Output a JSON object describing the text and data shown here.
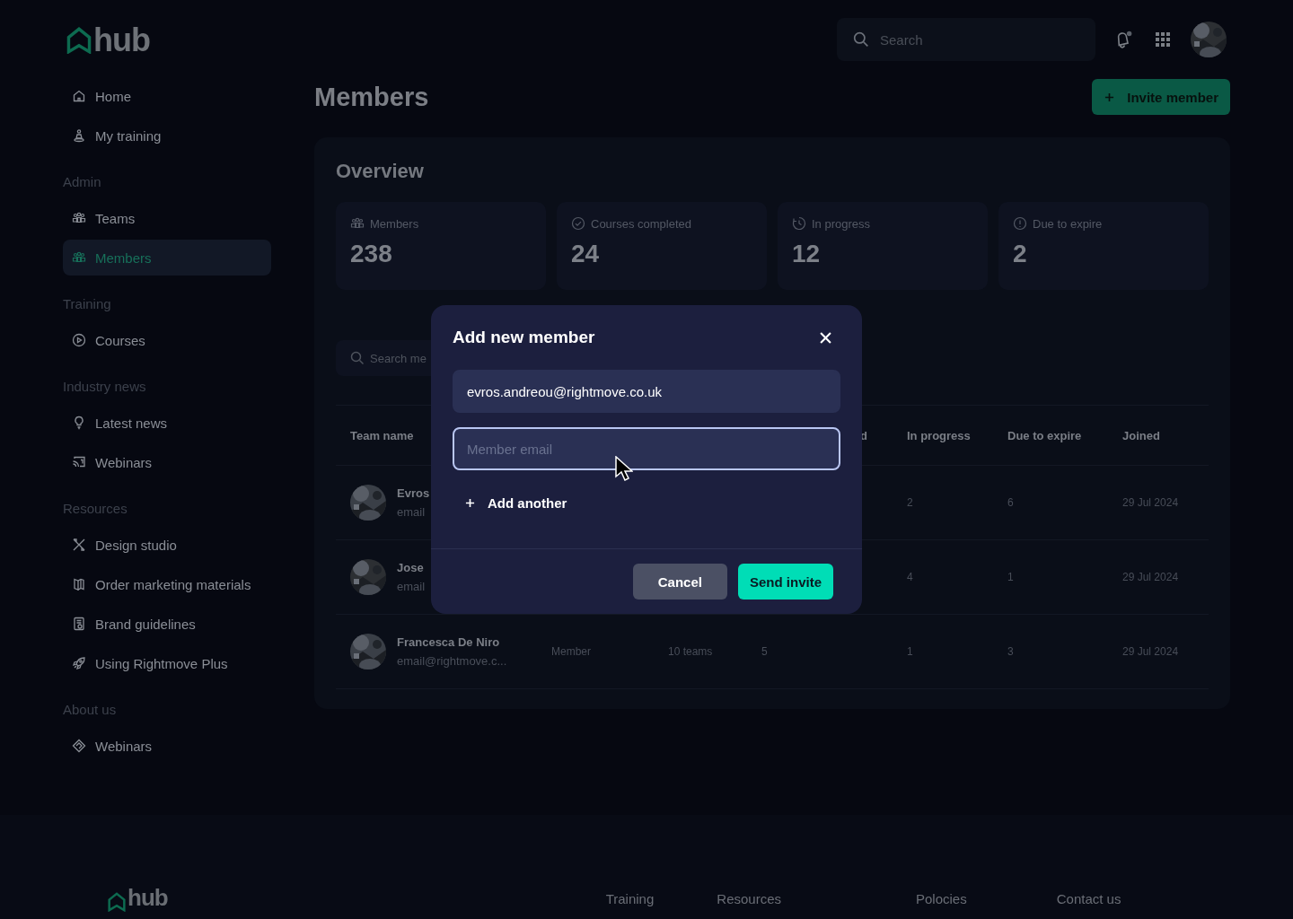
{
  "logo": {
    "text": "hub"
  },
  "header": {
    "search": {
      "placeholder": "Search"
    }
  },
  "sidebar": {
    "groups": [
      {
        "items": [
          {
            "label": "Home",
            "selected": false
          },
          {
            "label": "My training",
            "selected": false
          }
        ]
      },
      {
        "heading": "Admin",
        "items": [
          {
            "label": "Teams",
            "selected": false
          },
          {
            "label": "Members",
            "selected": true
          }
        ]
      },
      {
        "heading": "Training",
        "items": [
          {
            "label": "Courses",
            "selected": false
          }
        ]
      },
      {
        "heading": "Industry news",
        "items": [
          {
            "label": "Latest news",
            "selected": false
          },
          {
            "label": "Webinars",
            "selected": false
          }
        ]
      },
      {
        "heading": "Resources",
        "items": [
          {
            "label": "Design studio",
            "selected": false
          },
          {
            "label": "Order marketing materials",
            "selected": false
          },
          {
            "label": "Brand guidelines",
            "selected": false
          },
          {
            "label": "Using Rightmove Plus",
            "selected": false
          }
        ]
      },
      {
        "heading": "About us",
        "items": [
          {
            "label": "Webinars",
            "selected": false
          }
        ]
      }
    ]
  },
  "page": {
    "title": "Members",
    "invite_button": "Invite member"
  },
  "overview": {
    "title": "Overview",
    "stats": [
      {
        "label": "Members",
        "value": "238"
      },
      {
        "label": "Courses completed",
        "value": "24"
      },
      {
        "label": "In progress",
        "value": "12"
      },
      {
        "label": "Due to expire",
        "value": "2"
      }
    ]
  },
  "table": {
    "search": {
      "placeholder": "Search me"
    },
    "header": {
      "team_name": "Team name",
      "column_4": "d",
      "in_progress": "In progress",
      "due_to_expire": "Due to expire",
      "joined": "Joined"
    },
    "rows": [
      {
        "name": "Evros",
        "email": "email",
        "in_progress": "2",
        "due_to_expire": "6",
        "joined": "29 Jul 2024"
      },
      {
        "name": "Jose",
        "email": "email",
        "in_progress": "4",
        "due_to_expire": "1",
        "joined": "29 Jul 2024"
      },
      {
        "name": "Francesca De Niro",
        "email": "email@rightmove.c...",
        "column_2": "Member",
        "column_3": "10 teams",
        "column_4": "5",
        "in_progress": "1",
        "due_to_expire": "3",
        "joined": "29 Jul 2024"
      }
    ]
  },
  "dialog": {
    "title": "Add new member",
    "emails": [
      {
        "value": "evros.andreou@rightmove.co.uk",
        "focused": false
      },
      {
        "placeholder": "Member email",
        "focused": true
      }
    ],
    "add_another": "Add another",
    "cancel": "Cancel",
    "send": "Send invite"
  },
  "footer": {
    "logo": "hub",
    "links": [
      "Training",
      "Resources",
      "Polocies",
      "Contact us"
    ]
  }
}
